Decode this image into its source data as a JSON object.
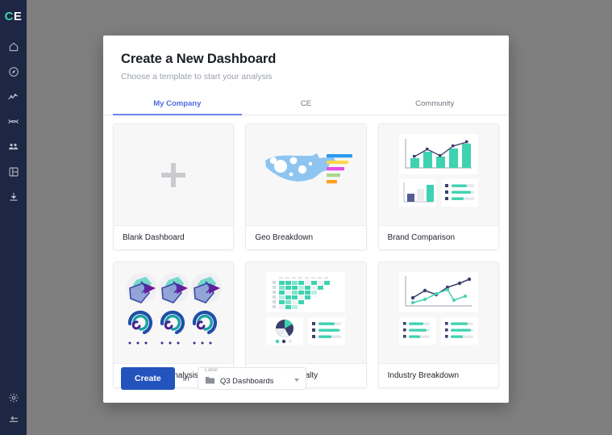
{
  "sidebar": {
    "logo": {
      "first": "C",
      "second": "E"
    },
    "items": [
      {
        "icon": "home-icon",
        "label": "Home"
      },
      {
        "icon": "compass-icon",
        "label": "Explore"
      },
      {
        "icon": "trending-up-icon",
        "label": "Analytics"
      },
      {
        "icon": "funnel-flow-icon",
        "label": "Flows"
      },
      {
        "icon": "people-icon",
        "label": "Audiences"
      },
      {
        "icon": "dashboard-layout-icon",
        "label": "Dashboards"
      },
      {
        "icon": "download-icon",
        "label": "Downloads"
      }
    ],
    "bottom_items": [
      {
        "icon": "gear-icon",
        "label": "Settings"
      },
      {
        "icon": "collapse-arrow-icon",
        "label": "Collapse"
      }
    ]
  },
  "modal": {
    "title": "Create a New Dashboard",
    "subtitle": "Choose a template to start your analysis",
    "tabs": [
      {
        "label": "My Company",
        "active": true
      },
      {
        "label": "CE",
        "active": false
      },
      {
        "label": "Community",
        "active": false
      }
    ],
    "templates": [
      {
        "name": "Blank Dashboard",
        "thumb": "plus"
      },
      {
        "name": "Geo Breakdown",
        "thumb": "geo"
      },
      {
        "name": "Brand Comparison",
        "thumb": "brand"
      },
      {
        "name": "Multi-Cohort Analysis",
        "thumb": "cohort"
      },
      {
        "name": "Customer Loyalty",
        "thumb": "loyalty"
      },
      {
        "name": "Industry Breakdown",
        "thumb": "industry"
      }
    ],
    "footer": {
      "create_label": "Create",
      "in_label": "in",
      "select_label": "Label",
      "select_value": "Q3 Dashboards"
    }
  },
  "colors": {
    "sidebar_bg": "#1d2642",
    "logo_teal": "#3ed2b0",
    "accent_blue": "#2353bd",
    "tab_active": "#4e6ce0",
    "teal": "#3ed2b0",
    "navy": "#3b3f6b",
    "map_blue": "#8ec5f0",
    "bar_blue": "#2b9bef",
    "bar_yellow": "#ffd84d",
    "bar_magenta": "#e84de8",
    "bar_green": "#a8d98a",
    "bar_orange": "#ff9d1e"
  }
}
